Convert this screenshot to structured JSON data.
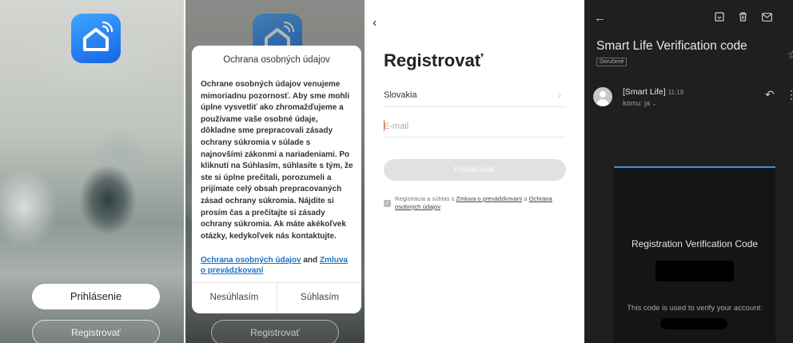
{
  "screen1": {
    "login_label": "Prihlásenie",
    "register_label": "Registrovať"
  },
  "screen2": {
    "modal_title": "Ochrana osobných údajov",
    "modal_body": "Ochrane osobných údajov venujeme mimoriadnu pozornosť. Aby sme mohli úplne vysvetliť ako zhromažďujeme a používame vaše osobné údaje, dôkladne sme prepracovali zásady ochrany súkromia v súlade s najnovšími zákonmi a nariadeniami. Po kliknutí na Súhlasím, súhlasíte s tým, že ste si úplne prečítali, porozumeli a prijímate celý obsah prepracovaných zásad ochrany súkromia. Nájdite si prosím čas a prečítajte si zásady ochrany súkromia. Ak máte akékoľvek otázky, kedykoľvek nás kontaktujte.",
    "privacy_link": "Ochrana osobných údajov",
    "and_text": "and",
    "terms_link": "Zmluva o prevádzkovaní",
    "disagree_label": "Nesúhlasím",
    "agree_label": "Súhlasím",
    "register_label": "Registrovať"
  },
  "screen3": {
    "back_icon": "back-arrow-icon",
    "title": "Registrovať",
    "country": "Slovakia",
    "email_placeholder": "E-mail",
    "email_value": "",
    "continue_label": "Pokračovať",
    "agree_prefix": "Registrácia a súhlas s",
    "terms_link": "Zmluva o prevádzkovaní",
    "agree_mid": "a",
    "privacy_link": "Ochrana osobných údajov"
  },
  "screen4": {
    "subject": "Smart Life Verification code",
    "label_chip": "Doručené",
    "sender": "[Smart Life]",
    "time": "11:19",
    "recipient": "komu: ja",
    "card_title": "Registration Verification Code",
    "card_desc": "This code is used to verify your account:"
  },
  "colors": {
    "app_icon": "#1E7BF0",
    "link": "#1a73c8",
    "dark_bg": "#1f1f1f",
    "card_accent": "#3e8fd8"
  }
}
